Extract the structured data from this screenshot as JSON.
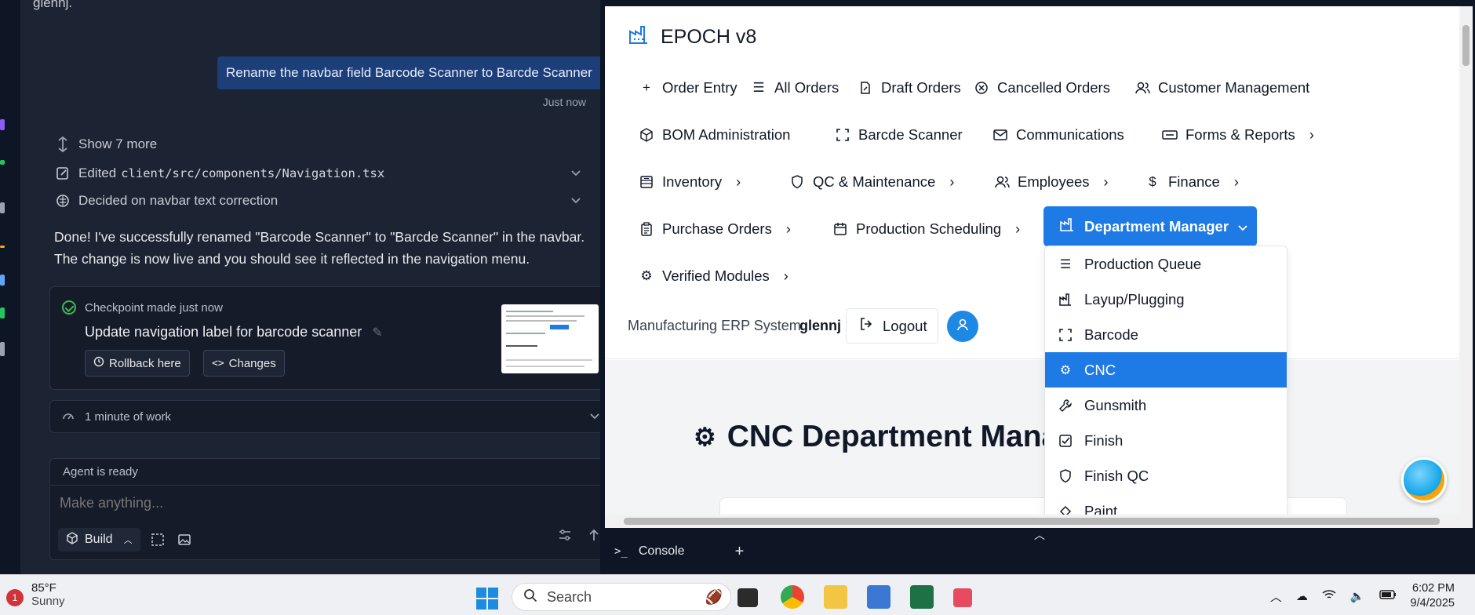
{
  "agent": {
    "truncated_line": "glennj.",
    "user_message": "Rename the navbar field Barcode Scanner to Barcde Scanner",
    "user_message_time": "Just now",
    "show_more": "Show 7 more",
    "edited_label": "Edited",
    "edited_file": "client/src/components/Navigation.tsx",
    "decided": "Decided on navbar text correction",
    "reply_line1": "Done! I've successfully renamed \"Barcode Scanner\" to \"Barcde Scanner\" in the navbar.",
    "reply_line2": "The change is now live and you should see it reflected in the navigation menu.",
    "checkpoint": {
      "title": "Checkpoint made just now",
      "description": "Update navigation label for barcode scanner",
      "rollback": "Rollback here",
      "changes": "Changes"
    },
    "work_time": "1 minute of work",
    "composer": {
      "status": "Agent is ready",
      "placeholder": "Make anything...",
      "build_label": "Build"
    }
  },
  "preview": {
    "brand": "EPOCH v8",
    "nav": [
      {
        "label": "Order Entry",
        "icon": "plus-icon"
      },
      {
        "label": "All Orders",
        "icon": "list-icon"
      },
      {
        "label": "Draft Orders",
        "icon": "edit-document-icon"
      },
      {
        "label": "Cancelled Orders",
        "icon": "x-circle-icon"
      },
      {
        "label": "Customer Management",
        "icon": "users-icon"
      },
      {
        "label": "BOM Administration",
        "icon": "package-icon"
      },
      {
        "label": "Barcde Scanner",
        "icon": "scan-icon"
      },
      {
        "label": "Communications",
        "icon": "mail-icon"
      },
      {
        "label": "Forms & Reports",
        "icon": "form-icon"
      },
      {
        "label": "Inventory",
        "icon": "archive-icon"
      },
      {
        "label": "QC & Maintenance",
        "icon": "shield-icon"
      },
      {
        "label": "Employees",
        "icon": "users-icon"
      },
      {
        "label": "Finance",
        "icon": "dollar-icon"
      },
      {
        "label": "Purchase Orders",
        "icon": "clipboard-icon"
      },
      {
        "label": "Production Scheduling",
        "icon": "calendar-icon"
      },
      {
        "label": "Department Manager",
        "icon": "factory-icon"
      },
      {
        "label": "Verified Modules",
        "icon": "gear-icon"
      }
    ],
    "subtitle": "Manufacturing ERP System",
    "username": "glennj",
    "logout": "Logout",
    "page_title": "CNC Department Mana",
    "dropdown": [
      {
        "label": "Production Queue",
        "icon": "list-icon"
      },
      {
        "label": "Layup/Plugging",
        "icon": "factory-icon"
      },
      {
        "label": "Barcode",
        "icon": "scan-icon"
      },
      {
        "label": "CNC",
        "icon": "gear-icon"
      },
      {
        "label": "Gunsmith",
        "icon": "wrench-icon"
      },
      {
        "label": "Finish",
        "icon": "checkbox-icon"
      },
      {
        "label": "Finish QC",
        "icon": "shield-icon"
      },
      {
        "label": "Paint",
        "icon": "paint-icon"
      }
    ]
  },
  "console": {
    "tab": "Console",
    "add": "+"
  },
  "taskbar": {
    "notification_count": "1",
    "temperature": "85°F",
    "condition": "Sunny",
    "search": "Search",
    "time": "6:02 PM",
    "date": "9/4/2025"
  },
  "colors": {
    "accent": "#1e7be6",
    "panel": "#1c2333",
    "user_bubble": "#1c3f7a"
  }
}
